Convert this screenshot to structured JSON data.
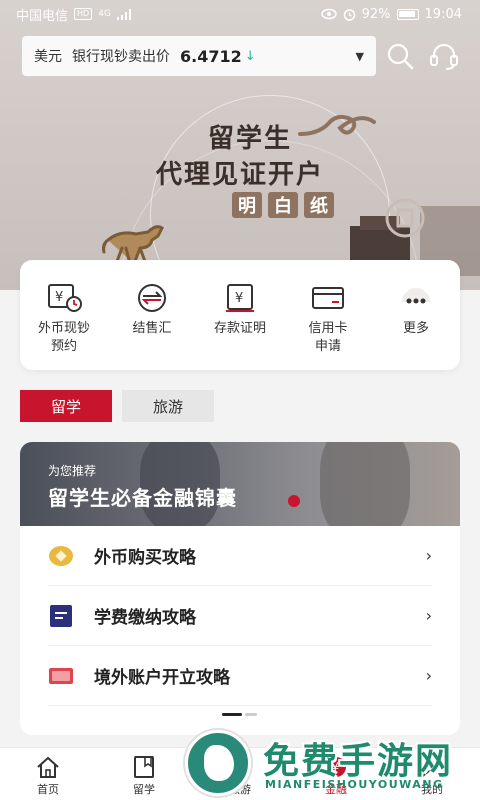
{
  "status_bar": {
    "carrier": "中国电信",
    "net_badge": "HD",
    "signal": "4G",
    "battery": "92%",
    "time": "19:04"
  },
  "rate": {
    "currency": "美元",
    "label": "银行现钞卖出价",
    "value": "6.4712",
    "trend": "down",
    "trend_color": "#23b59a"
  },
  "hero": {
    "line1": "留学生",
    "line2": "代理见证开户",
    "tag": [
      "明",
      "白",
      "纸"
    ]
  },
  "services": [
    {
      "label": "外币现钞\n预约",
      "icon": "currency-clock-icon"
    },
    {
      "label": "结售汇",
      "icon": "exchange-icon"
    },
    {
      "label": "存款证明",
      "icon": "deposit-certificate-icon"
    },
    {
      "label": "信用卡\n申请",
      "icon": "credit-card-icon"
    },
    {
      "label": "更多",
      "icon": "more-icon"
    }
  ],
  "tabs": [
    {
      "label": "留学",
      "active": true
    },
    {
      "label": "旅游",
      "active": false
    }
  ],
  "recommend": {
    "subtitle": "为您推荐",
    "title": "留学生必备金融锦囊",
    "items": [
      {
        "label": "外币购买攻略",
        "icon": "coin-icon"
      },
      {
        "label": "学费缴纳攻略",
        "icon": "document-icon"
      },
      {
        "label": "境外账户开立攻略",
        "icon": "card-icon"
      }
    ]
  },
  "nav": [
    {
      "label": "首页",
      "icon": "home-icon"
    },
    {
      "label": "留学",
      "icon": "book-icon"
    },
    {
      "label": "旅游",
      "icon": "travel-icon"
    },
    {
      "label": "金融",
      "icon": "finance-icon",
      "active": true
    },
    {
      "label": "我的",
      "icon": "user-icon"
    }
  ],
  "watermark": {
    "cn": "免费手游网",
    "en": "MIANFEISHOUYOUWANG"
  },
  "colors": {
    "brand_red": "#c8152d",
    "hero_bg": "#d4ccc9"
  }
}
